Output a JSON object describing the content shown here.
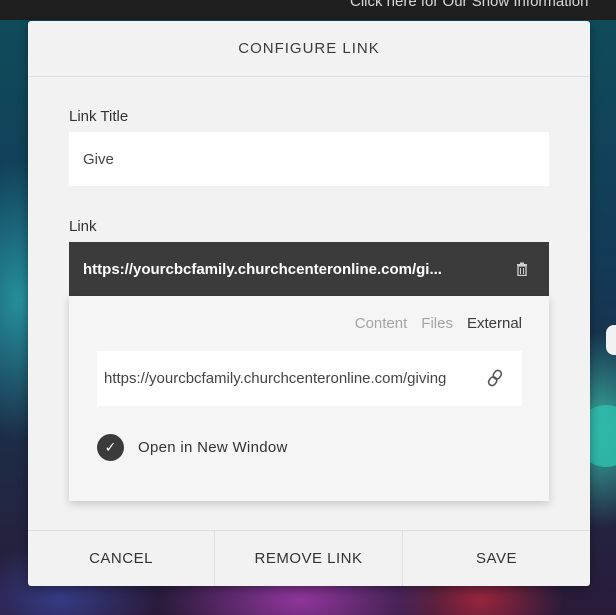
{
  "background": {
    "banner_text": "Click here for Our Show Information"
  },
  "dialog": {
    "title": "CONFIGURE LINK",
    "link_title_label": "Link Title",
    "link_title_value": "Give",
    "link_label": "Link",
    "link_value": "https://yourcbcfamily.churchcenteronline.com/giving",
    "link_display": "https://yourcbcfamily.churchcenteronline.com/gi...",
    "panel": {
      "tabs": [
        {
          "label": "Content",
          "active": false
        },
        {
          "label": "Files",
          "active": false
        },
        {
          "label": "External",
          "active": true
        }
      ],
      "url_value": "https://yourcbcfamily.churchcenteronline.com/giving",
      "open_new_window_label": "Open in New Window",
      "open_new_window_checked": true
    },
    "buttons": {
      "cancel": "CANCEL",
      "remove": "REMOVE LINK",
      "save": "SAVE"
    }
  },
  "icons": {
    "trash": "trash-icon",
    "chain": "chain-link-icon",
    "check": "checkmark-icon"
  }
}
